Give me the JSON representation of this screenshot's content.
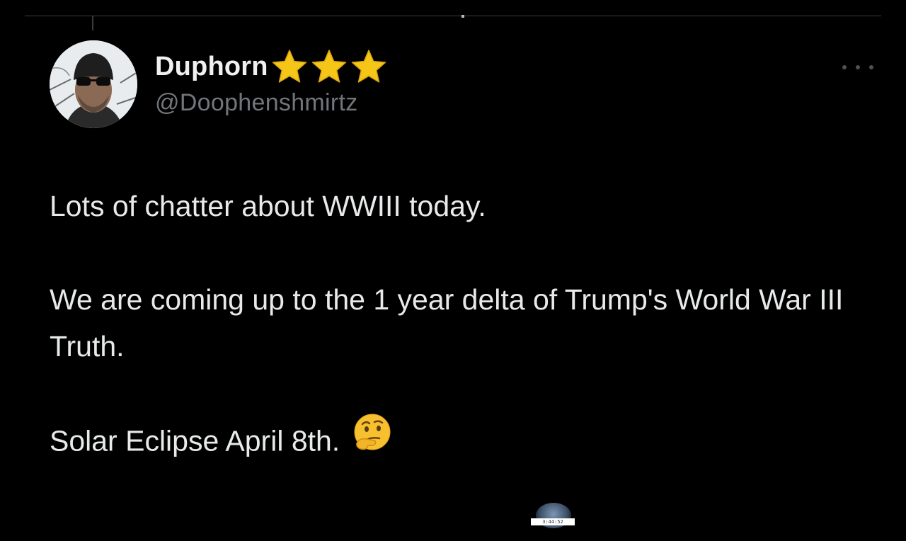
{
  "user": {
    "display_name": "Duphorn",
    "badges": [
      "star-icon",
      "star-icon",
      "star-icon"
    ],
    "handle": "@Doophenshmirtz"
  },
  "tweet": {
    "paragraphs": [
      "Lots of chatter about WWIII today.",
      "We are coming up to the 1 year delta of Trump's World War III Truth.",
      "Solar Eclipse April 8th."
    ],
    "emoji": "thinking-face-icon"
  },
  "menu": {
    "icon": "more-options-icon"
  },
  "video_scrubber": {
    "timestamp": "3:44:52"
  },
  "colors": {
    "background": "#000000",
    "text": "#e7e9ea",
    "secondary_text": "#71767b",
    "star": "#f5c518",
    "divider": "#3a3d40"
  }
}
